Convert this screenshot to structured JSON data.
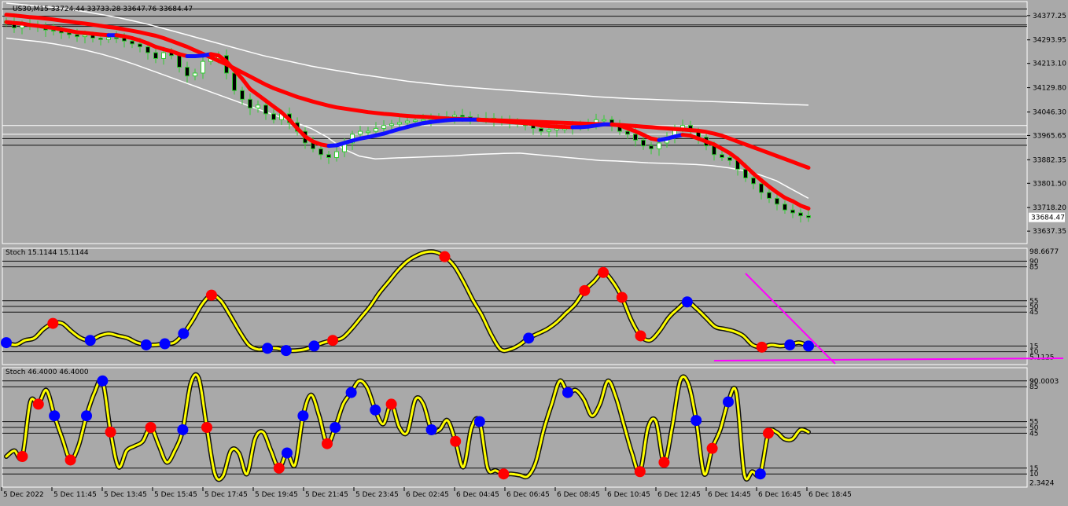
{
  "header": {
    "symbol_line": "US30,M15  33724.44 33733.28 33647.76 33684.47"
  },
  "colors": {
    "background": "#a9a9a9",
    "ma_red": "#ff0000",
    "ma_blue": "#1010ff",
    "stoch_line": "#ffff00",
    "bull_candle": "#33cc33",
    "bear_candle": "#000000",
    "band": "#ffffff",
    "trendline": "#ff00ff",
    "dot_red": "#ff0000",
    "dot_blue": "#0000ff"
  },
  "chart_data": [
    {
      "type": "line",
      "name": "price",
      "ylim": [
        33600,
        34420
      ],
      "y_ticks": [
        "34377.25",
        "34293.95",
        "34213.10",
        "34129.80",
        "34046.30",
        "33965.65",
        "33882.35",
        "33801.50",
        "33718.20",
        "33637.35"
      ],
      "last_price": "33684.47",
      "horizontal_levels": [
        34400,
        34375,
        34345,
        34340,
        34000,
        33970,
        33955,
        33932
      ],
      "x_ticks": [
        "5 Dec 2022",
        "5 Dec 11:45",
        "5 Dec 13:45",
        "5 Dec 15:45",
        "5 Dec 17:45",
        "5 Dec 19:45",
        "5 Dec 21:45",
        "5 Dec 23:45",
        "6 Dec 02:45",
        "6 Dec 04:45",
        "6 Dec 06:45",
        "6 Dec 08:45",
        "6 Dec 10:45",
        "6 Dec 12:45",
        "6 Dec 14:45",
        "6 Dec 16:45",
        "6 Dec 18:45"
      ],
      "close": [
        34352,
        34335,
        34345,
        34342,
        34340,
        34328,
        34325,
        34318,
        34312,
        34305,
        34310,
        34300,
        34295,
        34302,
        34300,
        34290,
        34280,
        34270,
        34250,
        34230,
        34250,
        34240,
        34200,
        34170,
        34180,
        34220,
        34230,
        34240,
        34180,
        34120,
        34090,
        34060,
        34070,
        34040,
        34020,
        34040,
        34010,
        33980,
        33940,
        33920,
        33900,
        33890,
        33910,
        33940,
        33970,
        33980,
        33980,
        33990,
        34000,
        34005,
        34010,
        34015,
        34018,
        34020,
        34025,
        34030,
        34030,
        34035,
        34030,
        34025,
        34025,
        34025,
        34020,
        34015,
        34010,
        34005,
        34000,
        33990,
        33980,
        33985,
        33990,
        33990,
        33995,
        34000,
        34010,
        34020,
        34020,
        34000,
        33980,
        33970,
        33950,
        33930,
        33920,
        33940,
        33960,
        33990,
        34000,
        33980,
        33960,
        33930,
        33900,
        33890,
        33880,
        33850,
        33820,
        33800,
        33770,
        33750,
        33730,
        33710,
        33700,
        33690,
        33684
      ],
      "ma_fast": [
        34355,
        34352,
        34350,
        34345,
        34342,
        34338,
        34335,
        34330,
        34325,
        34320,
        34318,
        34315,
        34312,
        34310,
        34310,
        34306,
        34300,
        34292,
        34282,
        34270,
        34262,
        34255,
        34245,
        34238,
        34238,
        34240,
        34245,
        34240,
        34220,
        34190,
        34160,
        34125,
        34105,
        34085,
        34065,
        34045,
        34020,
        33990,
        33962,
        33945,
        33935,
        33930,
        33932,
        33940,
        33948,
        33955,
        33960,
        33966,
        33972,
        33980,
        33988,
        33995,
        34002,
        34008,
        34012,
        34015,
        34018,
        34020,
        34020,
        34020,
        34020,
        34018,
        34016,
        34014,
        34012,
        34010,
        34008,
        34005,
        34000,
        33998,
        33996,
        33995,
        33994,
        33994,
        33996,
        34000,
        34004,
        34004,
        34000,
        33990,
        33980,
        33968,
        33955,
        33950,
        33955,
        33962,
        33968,
        33965,
        33955,
        33945,
        33935,
        33920,
        33905,
        33885,
        33860,
        33835,
        33812,
        33790,
        33770,
        33752,
        33740,
        33725,
        33715
      ],
      "ma_slow": [
        34380,
        34378,
        34375,
        34372,
        34370,
        34367,
        34364,
        34360,
        34357,
        34353,
        34350,
        34346,
        34342,
        34338,
        34335,
        34330,
        34325,
        34320,
        34314,
        34308,
        34300,
        34290,
        34280,
        34270,
        34258,
        34246,
        34234,
        34222,
        34210,
        34196,
        34182,
        34168,
        34154,
        34140,
        34128,
        34118,
        34108,
        34098,
        34090,
        34082,
        34075,
        34068,
        34062,
        34058,
        34054,
        34050,
        34046,
        34043,
        34040,
        34038,
        34035,
        34033,
        34031,
        34030,
        34028,
        34026,
        34024,
        34023,
        34022,
        34021,
        34020,
        34019,
        34018,
        34017,
        34016,
        34015,
        34014,
        34013,
        34012,
        34011,
        34010,
        34009,
        34008,
        34007,
        34006,
        34005,
        34004,
        34003,
        34002,
        34000,
        33998,
        33996,
        33994,
        33992,
        33990,
        33988,
        33986,
        33984,
        33982,
        33978,
        33972,
        33965,
        33955,
        33945,
        33935,
        33925,
        33915,
        33905,
        33895,
        33885,
        33875,
        33865,
        33855
      ],
      "band_upper": [
        34420,
        34415,
        34410,
        34405,
        34398,
        34390,
        34380,
        34370,
        34358,
        34345,
        34330,
        34315,
        34300,
        34285,
        34270,
        34255,
        34240,
        34228,
        34216,
        34204,
        34194,
        34185,
        34176,
        34168,
        34160,
        34152,
        34146,
        34140,
        34135,
        34130,
        34126,
        34122,
        34118,
        34114,
        34110,
        34106,
        34102,
        34098,
        34095,
        34092,
        34090,
        34088,
        34086,
        34084,
        34082,
        34080,
        34078,
        34076,
        34074,
        34072,
        34070
      ],
      "band_lower": [
        34300,
        34294,
        34288,
        34280,
        34270,
        34258,
        34244,
        34228,
        34210,
        34190,
        34170,
        34150,
        34130,
        34110,
        34090,
        34070,
        34050,
        34030,
        34010,
        33990,
        33960,
        33920,
        33895,
        33885,
        33888,
        33890,
        33892,
        33894,
        33896,
        33900,
        33902,
        33904,
        33905,
        33900,
        33895,
        33890,
        33885,
        33880,
        33878,
        33875,
        33872,
        33870,
        33868,
        33866,
        33862,
        33855,
        33845,
        33830,
        33810,
        33780,
        33750
      ]
    },
    {
      "type": "line",
      "name": "stoch_1",
      "label": "Stoch 15.1144 15.1144",
      "ylim": [
        0,
        100
      ],
      "axis_labels": [
        "98.6677",
        "90",
        "85",
        "55",
        "50",
        "45",
        "15",
        "10",
        "5.1125"
      ],
      "levels": [
        90,
        85,
        55,
        50,
        45,
        15,
        10
      ],
      "values": [
        18,
        16,
        20,
        22,
        30,
        35,
        35,
        28,
        22,
        20,
        24,
        26,
        24,
        22,
        18,
        16,
        16,
        17,
        18,
        26,
        38,
        52,
        60,
        55,
        42,
        28,
        16,
        12,
        13,
        13,
        11,
        11,
        12,
        15,
        18,
        20,
        22,
        30,
        40,
        50,
        62,
        72,
        82,
        90,
        95,
        98,
        98,
        94,
        86,
        72,
        56,
        42,
        25,
        12,
        12,
        16,
        22,
        26,
        30,
        36,
        44,
        52,
        64,
        72,
        80,
        72,
        58,
        38,
        24,
        20,
        28,
        40,
        48,
        54,
        48,
        40,
        32,
        30,
        28,
        24,
        16,
        14,
        16,
        15,
        16,
        18,
        15
      ],
      "dots_red": [
        5,
        21,
        33,
        45,
        59,
        61,
        63,
        65,
        77
      ],
      "dots_blue": [
        0,
        9,
        14,
        16,
        18,
        27,
        29,
        31,
        53,
        70,
        80,
        82
      ]
    },
    {
      "type": "line",
      "name": "stoch_2",
      "label": "Stoch 46.4000 46.4000",
      "ylim": [
        0,
        100
      ],
      "axis_labels": [
        "90.0003",
        "90",
        "85",
        "55",
        "50",
        "45",
        "15",
        "10",
        "2.3424"
      ],
      "levels": [
        90,
        85,
        55,
        50,
        45,
        15,
        10
      ],
      "values": [
        25,
        30,
        25,
        72,
        70,
        82,
        60,
        40,
        22,
        34,
        60,
        80,
        90,
        46,
        16,
        30,
        34,
        38,
        50,
        35,
        20,
        30,
        48,
        88,
        92,
        50,
        10,
        8,
        30,
        28,
        10,
        40,
        46,
        30,
        15,
        28,
        18,
        60,
        78,
        60,
        36,
        50,
        70,
        80,
        90,
        84,
        65,
        53,
        70,
        50,
        46,
        74,
        70,
        48,
        48,
        56,
        38,
        16,
        50,
        55,
        15,
        13,
        10,
        10,
        9,
        8,
        20,
        48,
        70,
        90,
        80,
        82,
        74,
        60,
        70,
        90,
        76,
        52,
        28,
        12,
        50,
        55,
        20,
        50,
        90,
        88,
        56,
        10,
        32,
        48,
        72,
        80,
        10,
        12,
        10,
        45,
        46,
        40,
        40,
        48,
        46
      ],
      "dots_red": [
        2,
        4,
        8,
        13,
        18,
        25,
        34,
        40,
        48,
        56,
        62,
        70,
        79,
        82,
        88,
        95
      ],
      "dots_blue": [
        6,
        10,
        12,
        22,
        35,
        37,
        41,
        43,
        46,
        53,
        59,
        70,
        86,
        90,
        94
      ]
    }
  ]
}
